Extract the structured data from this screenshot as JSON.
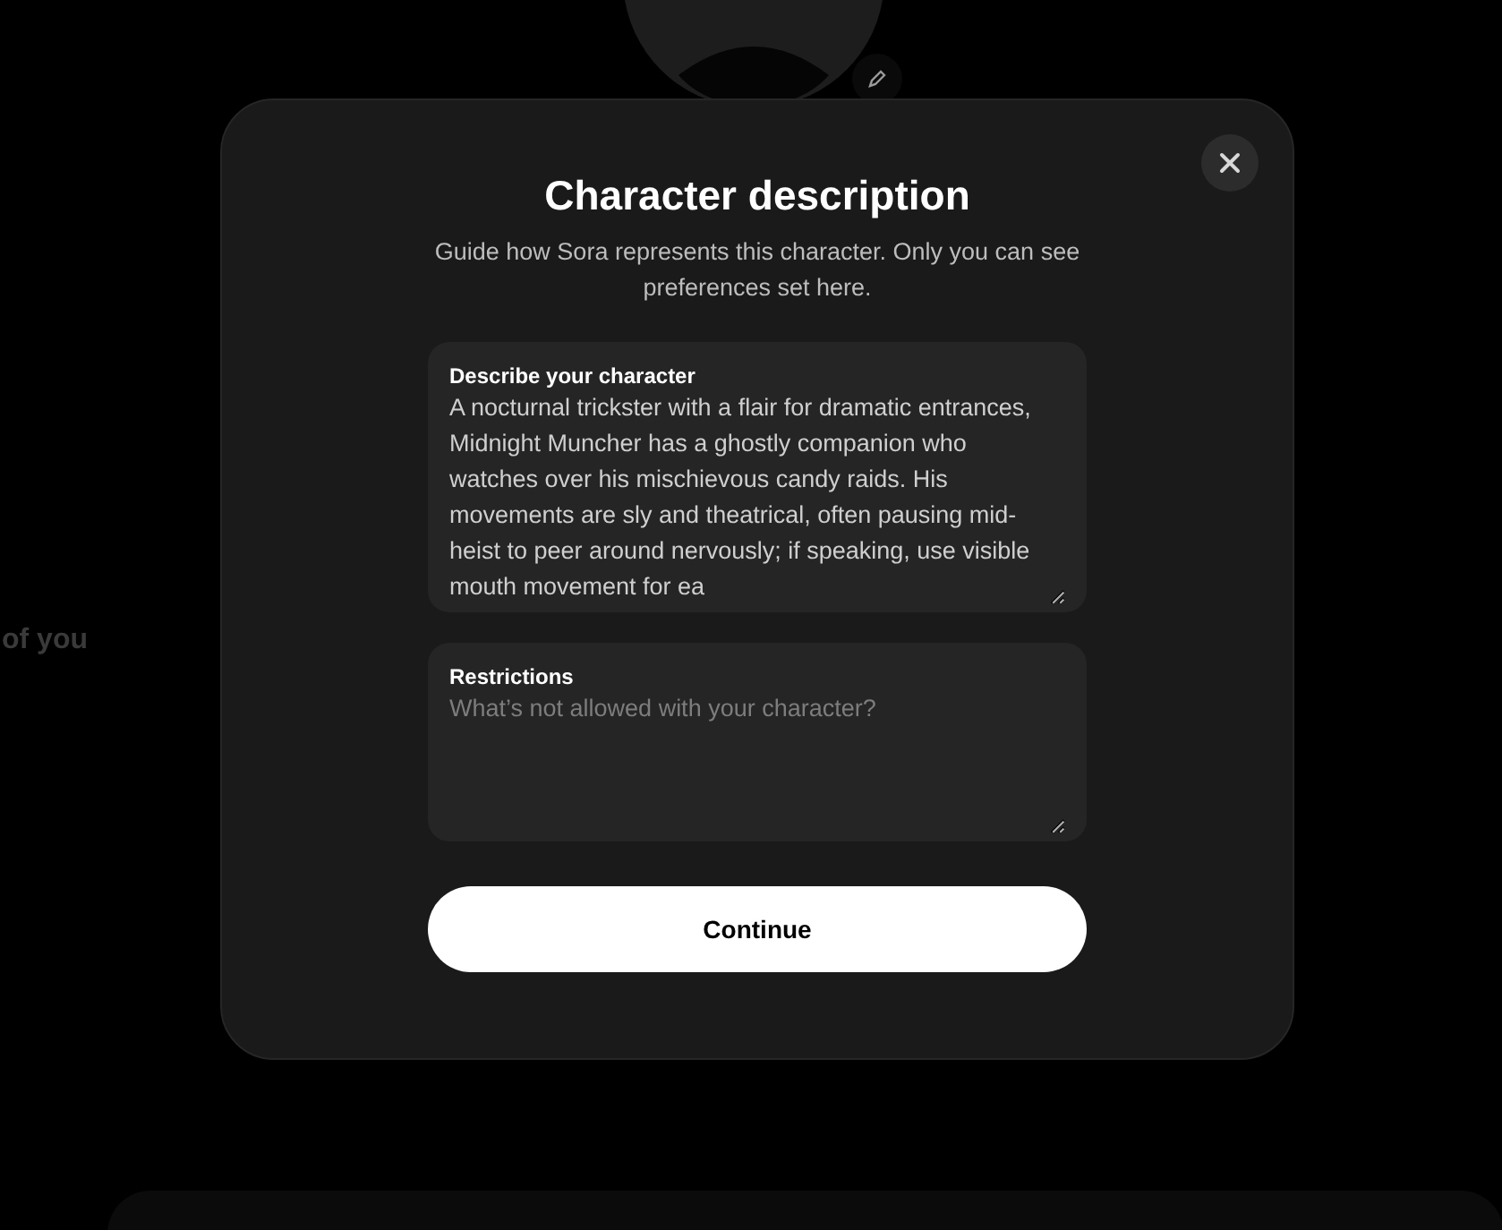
{
  "background": {
    "heading_fragment": "of you"
  },
  "dialog": {
    "title": "Character description",
    "subtitle": "Guide how Sora represents this character. Only you can see preferences set here.",
    "fields": [
      {
        "label": "Describe your character",
        "value": "A nocturnal trickster with a flair for dramatic entrances, Midnight Muncher has a ghostly companion who watches over his mischievous candy raids. His movements are sly and theatrical, often pausing mid-heist to peer around nervously; if speaking, use visible mouth movement for ea"
      },
      {
        "label": "Restrictions",
        "placeholder": "What’s not allowed with your character?"
      }
    ],
    "button": "Continue"
  }
}
